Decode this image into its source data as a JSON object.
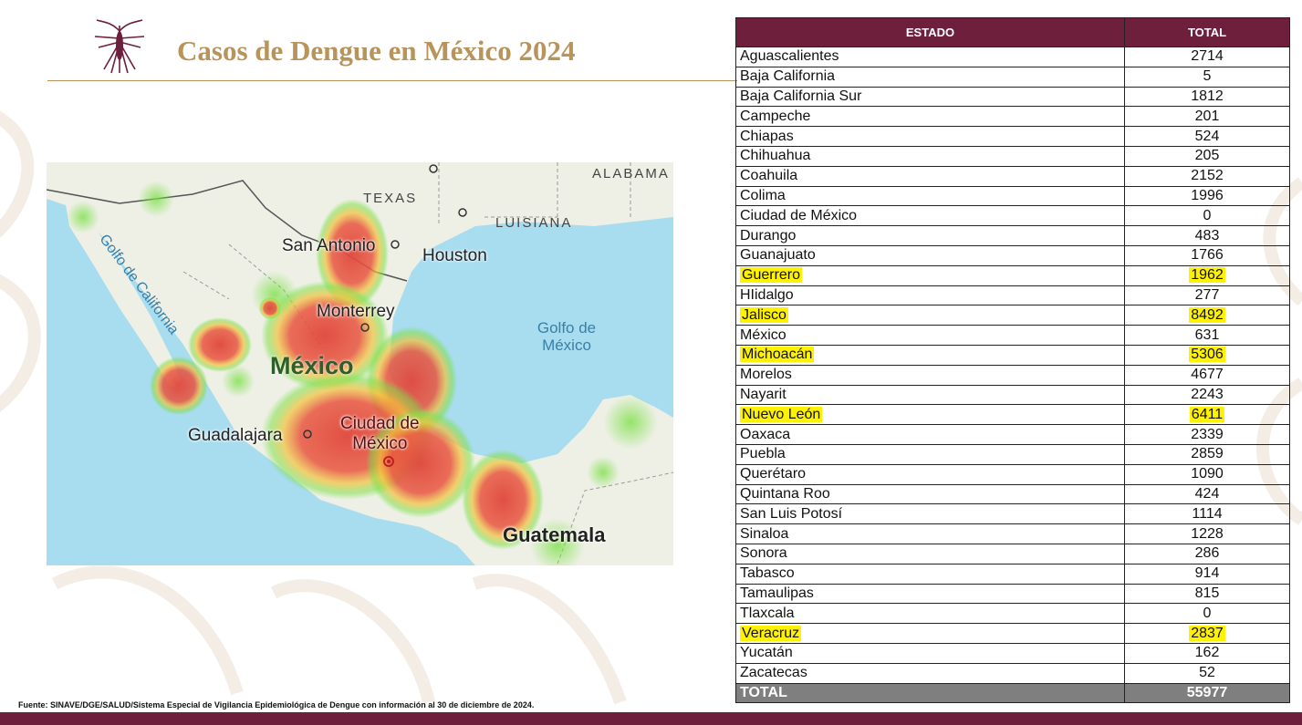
{
  "header": {
    "title": "Casos de Dengue en México 2024",
    "logo_icon": "mosquito-icon"
  },
  "map": {
    "labels": {
      "texas": "TEXAS",
      "alabama": "ALABAMA",
      "luisiana": "LUISIANA",
      "san_antonio": "San Antonio",
      "houston": "Houston",
      "golfo_california": "Golfo de California",
      "monterrey": "Monterrey",
      "golfo_mexico_1": "Golfo de",
      "golfo_mexico_2": "México",
      "mexico": "México",
      "guadalajara": "Guadalajara",
      "cdmx_1": "Ciudad de",
      "cdmx_2": "México",
      "guatemala": "Guatemala"
    }
  },
  "table": {
    "headers": {
      "state": "ESTADO",
      "total": "TOTAL"
    },
    "rows": [
      {
        "state": "Aguascalientes",
        "total": "2714",
        "highlight": false
      },
      {
        "state": "Baja California",
        "total": "5",
        "highlight": false
      },
      {
        "state": "Baja California Sur",
        "total": "1812",
        "highlight": false
      },
      {
        "state": "Campeche",
        "total": "201",
        "highlight": false
      },
      {
        "state": "Chiapas",
        "total": "524",
        "highlight": false
      },
      {
        "state": "Chihuahua",
        "total": "205",
        "highlight": false
      },
      {
        "state": "Coahuila",
        "total": "2152",
        "highlight": false
      },
      {
        "state": "Colima",
        "total": "1996",
        "highlight": false
      },
      {
        "state": "Ciudad de México",
        "total": "0",
        "highlight": false
      },
      {
        "state": "Durango",
        "total": "483",
        "highlight": false
      },
      {
        "state": "Guanajuato",
        "total": "1766",
        "highlight": false
      },
      {
        "state": "Guerrero",
        "total": "1962",
        "highlight": true
      },
      {
        "state": "HIidalgo",
        "total": "277",
        "highlight": false
      },
      {
        "state": "Jalisco",
        "total": "8492",
        "highlight": true
      },
      {
        "state": "México",
        "total": "631",
        "highlight": false
      },
      {
        "state": "Michoacán",
        "total": "5306",
        "highlight": true
      },
      {
        "state": "Morelos",
        "total": "4677",
        "highlight": false
      },
      {
        "state": "Nayarit",
        "total": "2243",
        "highlight": false
      },
      {
        "state": "Nuevo León",
        "total": "6411",
        "highlight": true
      },
      {
        "state": "Oaxaca",
        "total": "2339",
        "highlight": false
      },
      {
        "state": "Puebla",
        "total": "2859",
        "highlight": false
      },
      {
        "state": "Querétaro",
        "total": "1090",
        "highlight": false
      },
      {
        "state": "Quintana Roo",
        "total": "424",
        "highlight": false
      },
      {
        "state": "San Luis Potosí",
        "total": "1114",
        "highlight": false
      },
      {
        "state": "Sinaloa",
        "total": "1228",
        "highlight": false
      },
      {
        "state": "Sonora",
        "total": "286",
        "highlight": false
      },
      {
        "state": "Tabasco",
        "total": "914",
        "highlight": false
      },
      {
        "state": "Tamaulipas",
        "total": "815",
        "highlight": false
      },
      {
        "state": "Tlaxcala",
        "total": "0",
        "highlight": false
      },
      {
        "state": "Veracruz",
        "total": "2837",
        "highlight": true
      },
      {
        "state": "Yucatán",
        "total": "162",
        "highlight": false
      },
      {
        "state": "Zacatecas",
        "total": "52",
        "highlight": false
      }
    ],
    "total_row": {
      "label": "TOTAL",
      "value": "55977"
    }
  },
  "footer": {
    "source": "Fuente: SINAVE/DGE/SALUD/Sistema Especial de Vigilancia Epidemiológica de Dengue con información al 30 de diciembre de 2024."
  },
  "colors": {
    "brand": "#6e1f3b",
    "gold": "#b8935a",
    "highlight": "#fff200",
    "total_row": "#7f7f7f"
  }
}
